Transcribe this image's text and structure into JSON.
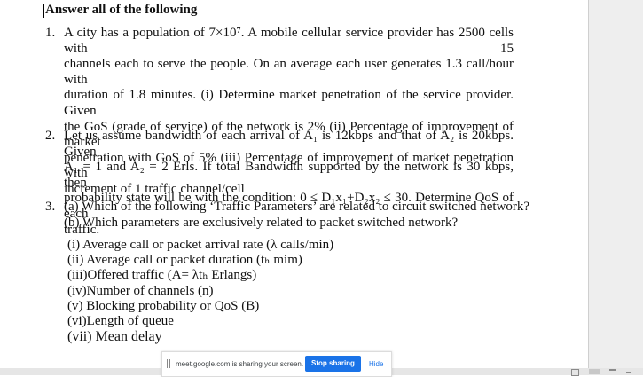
{
  "heading": "Answer all of the following",
  "questions": [
    {
      "number": "1.",
      "lines": [
        "A city has a population of 7×10⁷. A mobile cellular service provider has 2500 cells with 15",
        "channels each to serve the people. On an average each user generates 1.3 call/hour with",
        "duration of 1.8 minutes. (i) Determine market penetration of the service provider. Given",
        "the GoS (grade of service) of the network is 2% (ii) Percentage of improvement of market",
        "penetration with GoS of 5% (iii) Percentage of improvement of market penetration with",
        "increment of 1 traffic channel/cell"
      ]
    },
    {
      "number": "2.",
      "lines": [
        "Let us assume bandwidth of each arrival of A₁ is 12kbps and that of A₂ is 20kbps. Given",
        "A₁ = 1 and A₂ = 2 Erls. If total Bandwidth supported by the network is 30 kbps, then",
        "probability state will be with the condition:  0 ≤ D₁x₁+D₂x₂ ≤ 30. Determine QoS of each",
        "traffic."
      ]
    },
    {
      "number": "3.",
      "lines": [
        "(a) Which of the following ‘Traffic Parameters’ are related to circuit switched network?",
        "(b) Which parameters are exclusively related to packet switched network?"
      ],
      "items": [
        "(i)  Average call or packet arrival rate (λ calls/min)",
        "(ii) Average call or packet duration (tₕ mim)",
        "(iii)Offered traffic (A= λtₕ Erlangs)",
        "(iv)Number of channels (n)",
        "(v)  Blocking probability or QoS (B)",
        "(vi)Length of queue",
        "(vii)  Mean delay"
      ]
    }
  ],
  "share_bar": {
    "message": "meet.google.com is sharing your screen.",
    "stop_label": "Stop sharing",
    "hide_label": "Hide"
  }
}
